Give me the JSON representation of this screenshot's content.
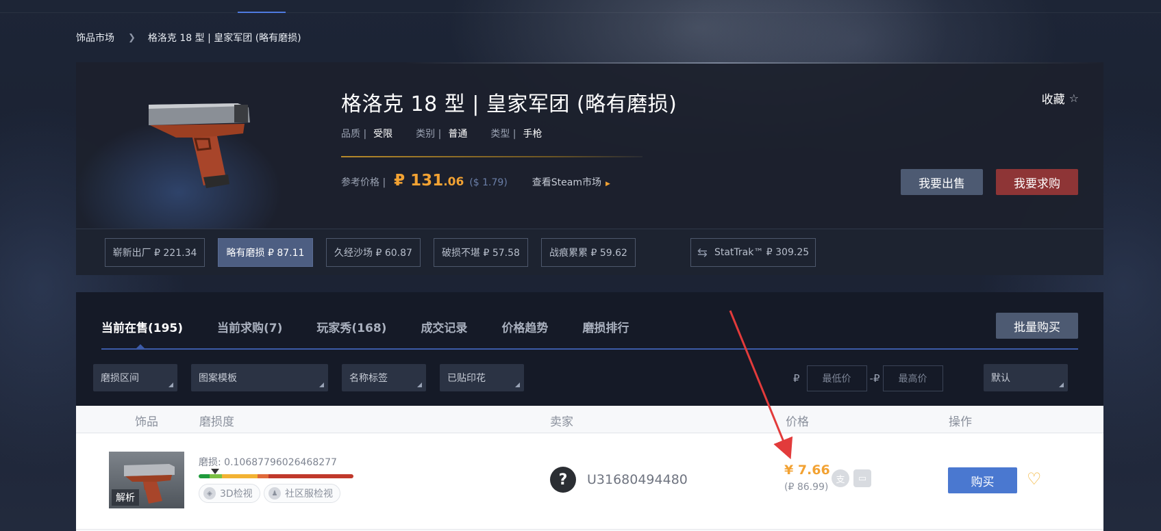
{
  "breadcrumb": {
    "root": "饰品市场",
    "current": "格洛克 18 型 | 皇家军团 (略有磨损)"
  },
  "item": {
    "title": "格洛克 18 型 | 皇家军团 (略有磨损)",
    "meta": [
      {
        "key": "品质 |",
        "value": "受限"
      },
      {
        "key": "类别 |",
        "value": "普通"
      },
      {
        "key": "类型 |",
        "value": "手枪"
      }
    ],
    "ref_price_label": "参考价格 |",
    "ref_price_int": "₽ 131",
    "ref_price_dec": ".06",
    "ref_price_usd": "($ 1.79)",
    "steam_link": "查看Steam市场",
    "favorite": "收藏",
    "sell_button": "我要出售",
    "buy_request_button": "我要求购"
  },
  "wear_tabs": [
    {
      "label": "崭新出厂 ₽ 221.34",
      "active": false
    },
    {
      "label": "略有磨损 ₽ 87.11",
      "active": true
    },
    {
      "label": "久经沙场 ₽ 60.87",
      "active": false
    },
    {
      "label": "破损不堪 ₽ 57.58",
      "active": false
    },
    {
      "label": "战痕累累 ₽ 59.62",
      "active": false
    },
    {
      "label": "StatTrak™ ₽ 309.25",
      "active": false
    }
  ],
  "market_tabs": [
    {
      "label": "当前在售(195)",
      "active": true
    },
    {
      "label": "当前求购(7)",
      "active": false
    },
    {
      "label": "玩家秀(168)",
      "active": false
    },
    {
      "label": "成交记录",
      "active": false
    },
    {
      "label": "价格趋势",
      "active": false
    },
    {
      "label": "磨损排行",
      "active": false
    }
  ],
  "batch_buy_button": "批量购买",
  "filters": {
    "wear_range": "磨损区间",
    "pattern": "图案模板",
    "name_tag": "名称标签",
    "stickers": "已贴印花",
    "currency_symbol": "₽",
    "range_sep": "-₽",
    "min_placeholder": "最低价",
    "max_placeholder": "最高价",
    "sort": "默认"
  },
  "list_headers": {
    "item": "饰品",
    "wear": "磨损度",
    "seller": "卖家",
    "price": "价格",
    "action": "操作"
  },
  "listing": {
    "inspect_label": "解析",
    "wear_text": "磨损: 0.10687796026468277",
    "wear_value": 0.10687796026468277,
    "view_3d": "3D检视",
    "view_server": "社区服检视",
    "seller_avatar": "?",
    "seller_name": "U31680494480",
    "price": "¥ 7.66",
    "price_sub": "(₽ 86.99)",
    "buy_button": "购买"
  },
  "colors": {
    "accent_blue": "#4a78d0",
    "gold": "#f2a233",
    "sell_btn": "#4d5a72",
    "buyreq_btn": "#8e3536",
    "arrow": "#e23b3b"
  }
}
